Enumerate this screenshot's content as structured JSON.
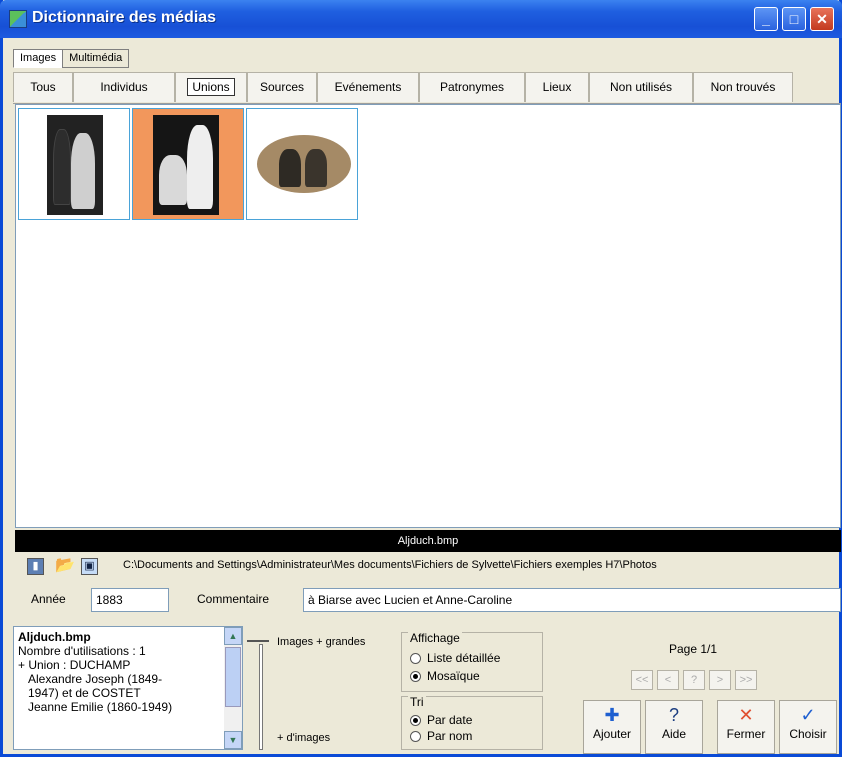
{
  "window": {
    "title": "Dictionnaire des médias"
  },
  "top_tabs": [
    {
      "label": "Images",
      "active": true
    },
    {
      "label": "Multimédia",
      "active": false
    }
  ],
  "category_tabs": [
    {
      "label": "Tous"
    },
    {
      "label": "Individus"
    },
    {
      "label": "Unions",
      "active": true
    },
    {
      "label": "Sources"
    },
    {
      "label": "Evénements"
    },
    {
      "label": "Patronymes"
    },
    {
      "label": "Lieux"
    },
    {
      "label": "Non utilisés"
    },
    {
      "label": "Non trouvés"
    }
  ],
  "selected_caption": "Aljduch.bmp",
  "path": "C:\\Documents and Settings\\Administrateur\\Mes documents\\Fichiers de Sylvette\\Fichiers exemples H7\\Photos",
  "year": {
    "label": "Année",
    "value": "1883"
  },
  "comment": {
    "label": "Commentaire",
    "value": "à Biarse avec Lucien et Anne-Caroline"
  },
  "info": {
    "filename": "Aljduch.bmp",
    "usage": "Nombre d'utilisations : 1",
    "lines": [
      "+ Union : DUCHAMP",
      "Alexandre Joseph (1849-",
      "1947) et de COSTET",
      "Jeanne Emilie (1860-1949)"
    ]
  },
  "slider": {
    "top_label": "Images + grandes",
    "bottom_label": "+ d'images"
  },
  "display": {
    "legend": "Affichage",
    "options": [
      {
        "label": "Liste détaillée",
        "checked": false
      },
      {
        "label": "Mosaïque",
        "checked": true
      }
    ]
  },
  "sort": {
    "legend": "Tri",
    "options": [
      {
        "label": "Par date",
        "checked": true
      },
      {
        "label": "Par nom",
        "checked": false
      }
    ]
  },
  "pager": {
    "label": "Page 1/1",
    "buttons": [
      "<<",
      "<",
      "?",
      ">",
      ">>"
    ]
  },
  "actions": [
    {
      "label": "Ajouter",
      "icon": "plus-icon",
      "glyph": "✚",
      "color": "#1e5fd0"
    },
    {
      "label": "Aide",
      "icon": "help-icon",
      "glyph": "?",
      "color": "#1b3d80"
    },
    {
      "label": "Fermer",
      "icon": "close-icon",
      "glyph": "✕",
      "color": "#e05030"
    },
    {
      "label": "Choisir",
      "icon": "check-icon",
      "glyph": "✓",
      "color": "#1e5fd0"
    }
  ]
}
